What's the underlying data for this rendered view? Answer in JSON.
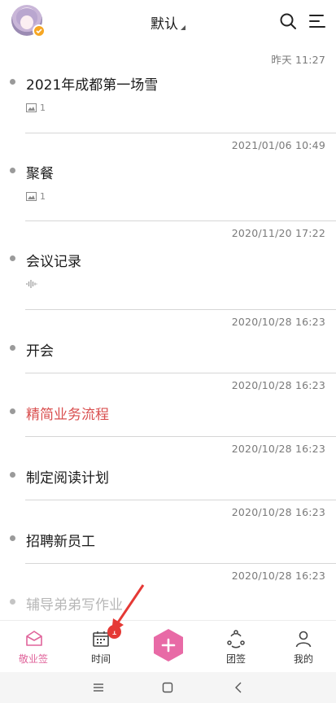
{
  "header": {
    "title": "默认",
    "icons": [
      "avatar",
      "search-icon",
      "menu-icon"
    ]
  },
  "notes": [
    {
      "time": "昨天   11:27",
      "title": "2021年成都第一场雪",
      "meta": "1",
      "meta_icon": "image-icon",
      "style": "normal"
    },
    {
      "time": "2021/01/06 10:49",
      "title": "聚餐",
      "meta": "1",
      "meta_icon": "image-icon",
      "style": "normal"
    },
    {
      "time": "2020/11/20 17:22",
      "title": "会议记录",
      "meta": "",
      "meta_icon": "audio-wave-icon",
      "style": "normal"
    },
    {
      "time": "2020/10/28 16:23",
      "title": "开会",
      "meta": "",
      "meta_icon": "",
      "style": "normal"
    },
    {
      "time": "2020/10/28 16:23",
      "title": "精简业务流程",
      "meta": "",
      "meta_icon": "",
      "style": "red"
    },
    {
      "time": "2020/10/28 16:23",
      "title": "制定阅读计划",
      "meta": "",
      "meta_icon": "",
      "style": "normal"
    },
    {
      "time": "2020/10/28 16:23",
      "title": "招聘新员工",
      "meta": "",
      "meta_icon": "",
      "style": "normal"
    },
    {
      "time": "2020/10/28 16:23",
      "title": "辅导弟弟写作业",
      "meta": "",
      "meta_icon": "",
      "style": "faded"
    }
  ],
  "tabbar": {
    "tabs": [
      {
        "label": "敬业签",
        "icon": "notes-tab-icon",
        "active": true
      },
      {
        "label": "时间",
        "icon": "calendar-icon",
        "active": false
      },
      {
        "label": "",
        "icon": "add-icon",
        "active": false
      },
      {
        "label": "团签",
        "icon": "team-icon",
        "active": false
      },
      {
        "label": "我的",
        "icon": "profile-icon",
        "active": false
      }
    ],
    "badge": "1"
  },
  "colors": {
    "accent": "#e0649b",
    "red_title": "#d94f4f",
    "badge": "#e53935",
    "add_button": "#e86aa6"
  },
  "system_nav": [
    "menu-nav-icon",
    "home-nav-icon",
    "back-nav-icon"
  ]
}
